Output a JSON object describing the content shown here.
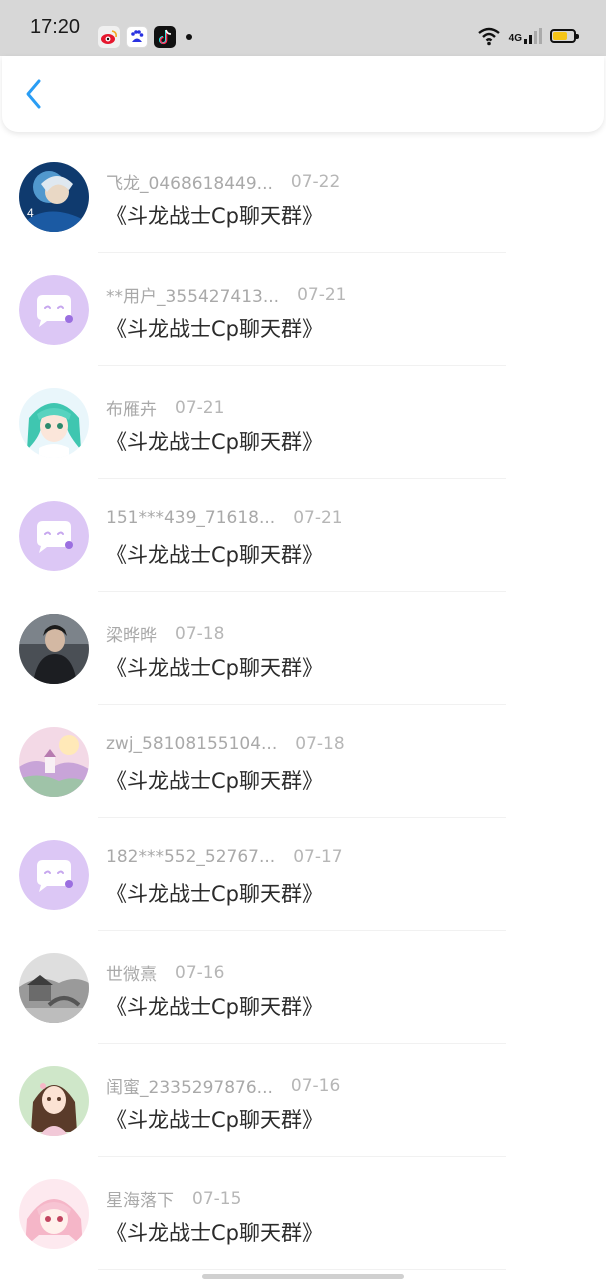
{
  "status_bar": {
    "time": "17:20",
    "notification_icons": [
      "weibo-icon",
      "baidu-icon",
      "tiktok-icon"
    ],
    "network": "4G",
    "battery_color": "#f5c518"
  },
  "nav": {
    "back_icon": "chevron-left-icon",
    "accent": "#2a9df4"
  },
  "messages": [
    {
      "name": "飞龙_0468618449...",
      "date": "07-22",
      "text": "《斗龙战士Cp聊天群》",
      "avatar": "anime-avatar-blue"
    },
    {
      "name": "**用户_355427413...",
      "date": "07-21",
      "text": "《斗龙战士Cp聊天群》",
      "avatar": "default-chat-avatar"
    },
    {
      "name": "布雁卉",
      "date": "07-21",
      "text": "《斗龙战士Cp聊天群》",
      "avatar": "anime-avatar-green-hair"
    },
    {
      "name": "151***439_71618...",
      "date": "07-21",
      "text": "《斗龙战士Cp聊天群》",
      "avatar": "default-chat-avatar"
    },
    {
      "name": "梁晔晔",
      "date": "07-18",
      "text": "《斗龙战士Cp聊天群》",
      "avatar": "photo-avatar-dark"
    },
    {
      "name": "zwj_58108155104...",
      "date": "07-18",
      "text": "《斗龙战士Cp聊天群》",
      "avatar": "landscape-avatar-pink"
    },
    {
      "name": "182***552_52767...",
      "date": "07-17",
      "text": "《斗龙战士Cp聊天群》",
      "avatar": "default-chat-avatar"
    },
    {
      "name": "世微熹",
      "date": "07-16",
      "text": "《斗龙战士Cp聊天群》",
      "avatar": "ink-landscape-avatar"
    },
    {
      "name": "闺蜜_2335297876...",
      "date": "07-16",
      "text": "《斗龙战士Cp聊天群》",
      "avatar": "anime-avatar-girl"
    },
    {
      "name": "星海落下",
      "date": "07-15",
      "text": "《斗龙战士Cp聊天群》",
      "avatar": "anime-avatar-pink-hair"
    }
  ]
}
